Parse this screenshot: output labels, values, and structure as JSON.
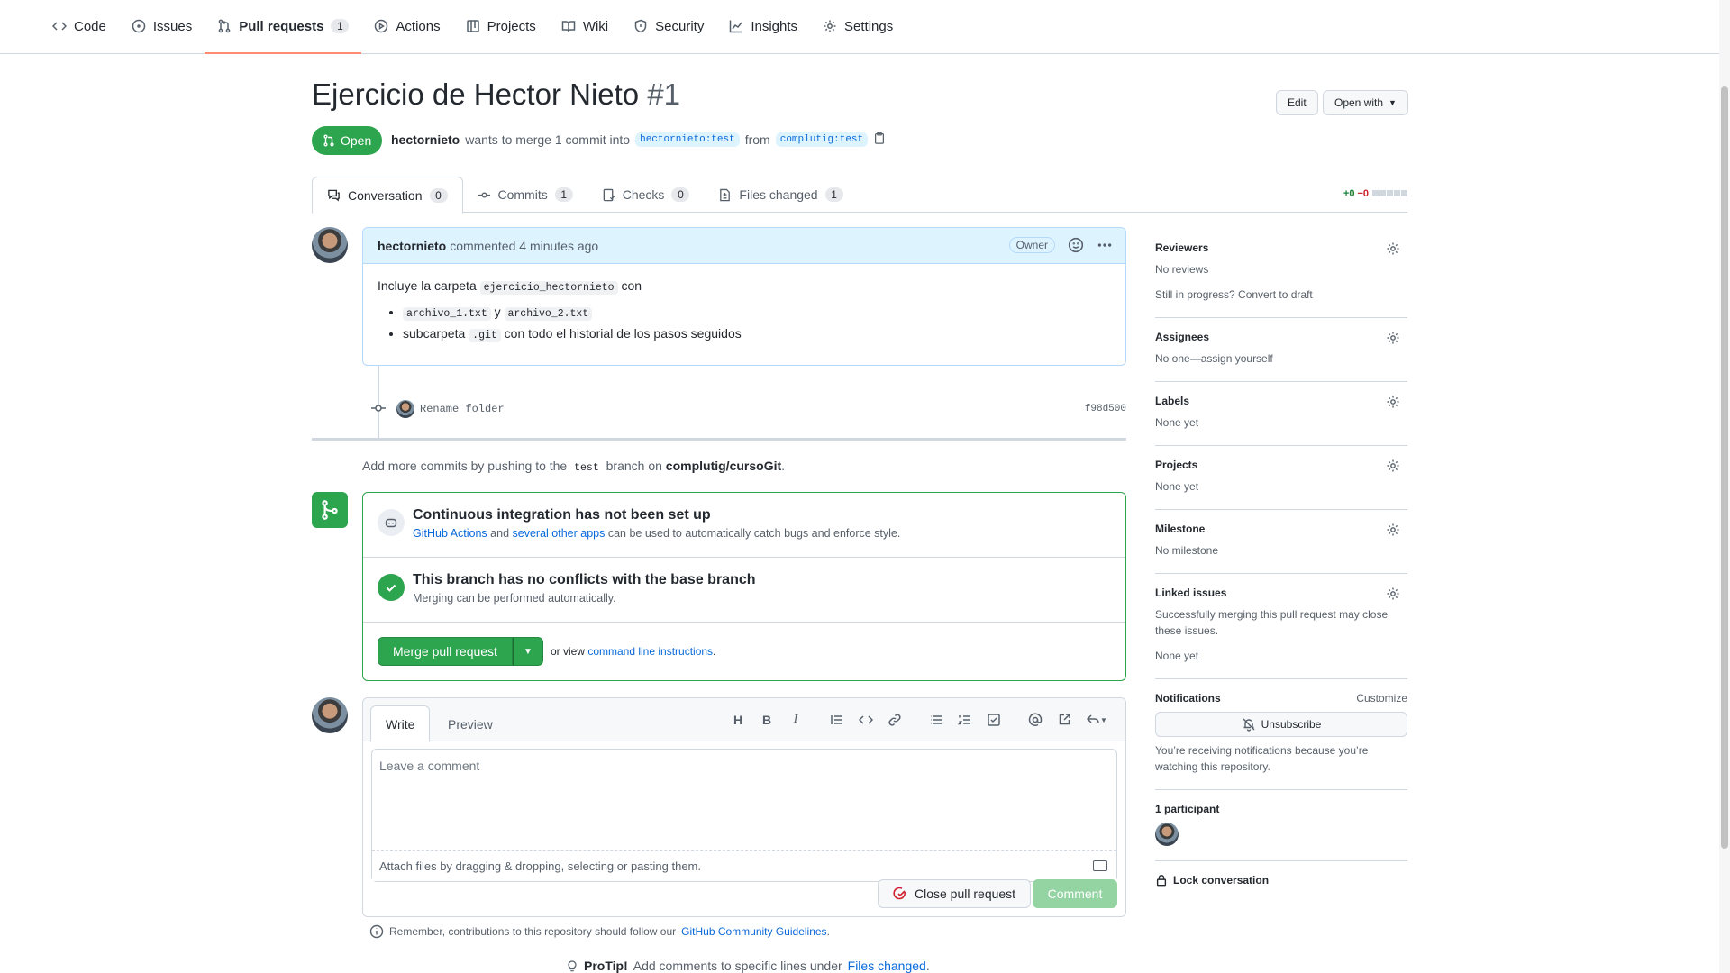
{
  "nav": {
    "items": [
      {
        "label": "Code",
        "icon": "code-icon"
      },
      {
        "label": "Issues",
        "icon": "issue-icon"
      },
      {
        "label": "Pull requests",
        "icon": "pull-request-icon",
        "count": "1"
      },
      {
        "label": "Actions",
        "icon": "play-icon"
      },
      {
        "label": "Projects",
        "icon": "table-icon"
      },
      {
        "label": "Wiki",
        "icon": "book-icon"
      },
      {
        "label": "Security",
        "icon": "shield-icon"
      },
      {
        "label": "Insights",
        "icon": "graph-icon"
      },
      {
        "label": "Settings",
        "icon": "gear-icon"
      }
    ],
    "active_index": 2
  },
  "pr": {
    "title": "Ejercicio de Hector Nieto",
    "number": "#1",
    "state": "Open",
    "author": "hectornieto",
    "merge_text": "wants to merge 1 commit into",
    "base_branch": "hectornieto:test",
    "from_text": "from",
    "head_branch": "complutig:test",
    "edit_label": "Edit",
    "open_with_label": "Open with"
  },
  "tabs": [
    {
      "label": "Conversation",
      "count": "0"
    },
    {
      "label": "Commits",
      "count": "1"
    },
    {
      "label": "Checks",
      "count": "0"
    },
    {
      "label": "Files changed",
      "count": "1"
    }
  ],
  "diffstat": {
    "additions": "+0",
    "deletions": "−0"
  },
  "comment": {
    "author": "hectornieto",
    "time": "commented 4 minutes ago",
    "badge": "Owner",
    "intro_pre": "Incluye la carpeta",
    "intro_code": "ejercicio_hectornieto",
    "intro_post": "con",
    "li1_code1": "archivo_1.txt",
    "li1_mid": "y",
    "li1_code2": "archivo_2.txt",
    "li2_pre": "subcarpeta",
    "li2_code": ".git",
    "li2_post": "con todo el historial de los pasos seguidos"
  },
  "commit": {
    "message": "Rename folder",
    "sha": "f98d500"
  },
  "push_note": {
    "pre": "Add more commits by pushing to the",
    "branch": "test",
    "mid": "branch on",
    "repo": "complutig/cursoGit",
    "post": "."
  },
  "mergebox": {
    "ci_title": "Continuous integration has not been set up",
    "ci_link1": "GitHub Actions",
    "ci_and": "and",
    "ci_link2": "several other apps",
    "ci_post": "can be used to automatically catch bugs and enforce style.",
    "conflict_title": "This branch has no conflicts with the base branch",
    "conflict_desc": "Merging can be performed automatically.",
    "merge_label": "Merge pull request",
    "or_view": "or view",
    "cli_link": "command line instructions",
    "cli_post": "."
  },
  "form": {
    "write_tab": "Write",
    "preview_tab": "Preview",
    "placeholder": "Leave a comment",
    "attach_text": "Attach files by dragging & dropping, selecting or pasting them.",
    "close_label": "Close pull request",
    "comment_label": "Comment"
  },
  "remember": {
    "pre": "Remember, contributions to this repository should follow our",
    "link": "GitHub Community Guidelines",
    "post": "."
  },
  "protip": {
    "label": "ProTip!",
    "pre": "Add comments to specific lines under",
    "link": "Files changed",
    "post": "."
  },
  "sidebar": {
    "reviewers_title": "Reviewers",
    "reviewers_value": "No reviews",
    "reviewers_draft": "Still in progress? Convert to draft",
    "assignees_title": "Assignees",
    "assignees_value": "No one—assign yourself",
    "labels_title": "Labels",
    "labels_value": "None yet",
    "projects_title": "Projects",
    "projects_value": "None yet",
    "milestone_title": "Milestone",
    "milestone_value": "No milestone",
    "linked_title": "Linked issues",
    "linked_desc": "Successfully merging this pull request may close these issues.",
    "linked_value": "None yet",
    "notifications_title": "Notifications",
    "customize": "Customize",
    "unsubscribe": "Unsubscribe",
    "notif_reason": "You’re receiving notifications because you’re watching this repository.",
    "participants": "1 participant",
    "lock": "Lock conversation"
  },
  "colors": {
    "green": "#2da44e",
    "link": "#0969da",
    "danger": "#cf222e",
    "nav_underline": "#fd8c73"
  }
}
